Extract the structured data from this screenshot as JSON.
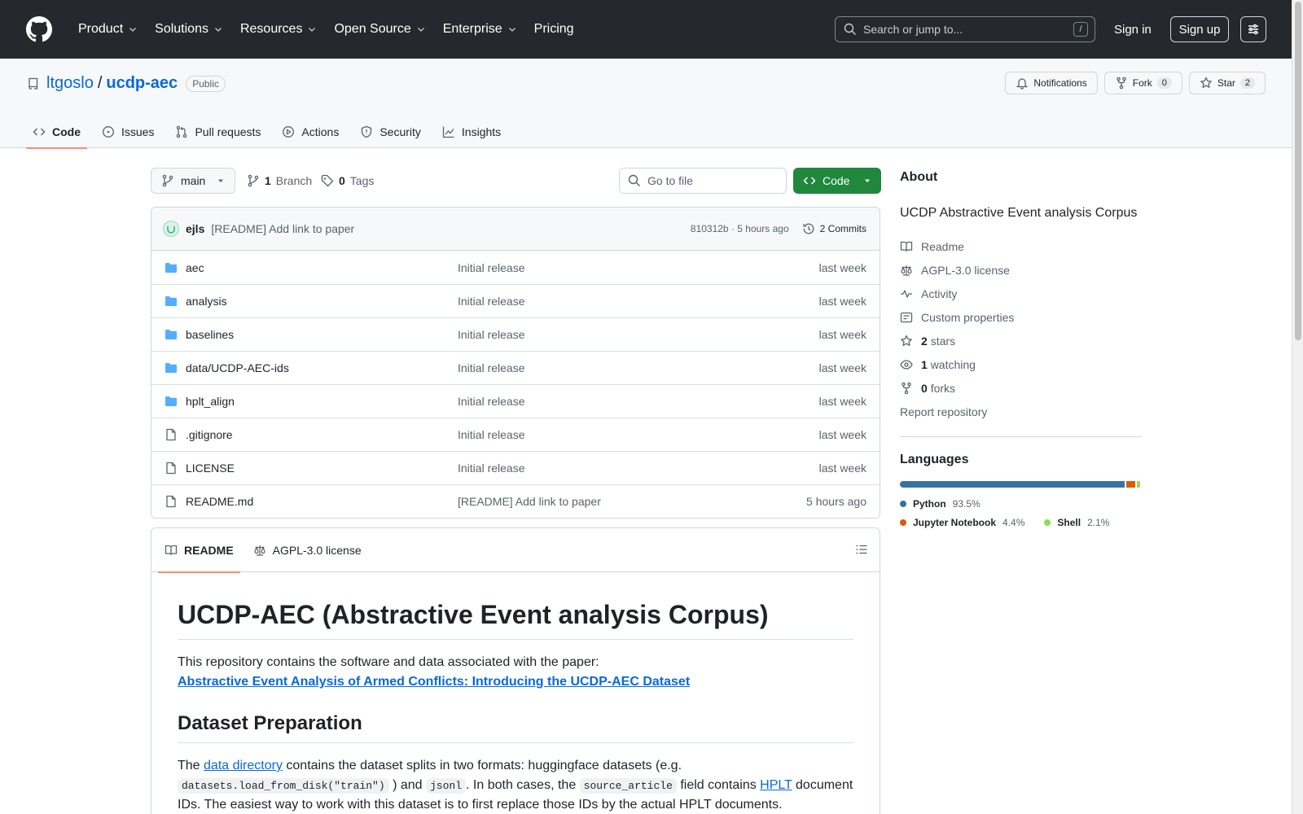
{
  "header": {
    "nav": [
      "Product",
      "Solutions",
      "Resources",
      "Open Source",
      "Enterprise",
      "Pricing"
    ],
    "search_placeholder": "Search or jump to...",
    "search_shortcut": "/",
    "sign_in": "Sign in",
    "sign_up": "Sign up"
  },
  "repo": {
    "owner": "ltgoslo",
    "separator": "/",
    "name": "ucdp-aec",
    "visibility": "Public",
    "notifications_label": "Notifications",
    "fork_label": "Fork",
    "fork_count": "0",
    "star_label": "Star",
    "star_count": "2",
    "tabs": [
      "Code",
      "Issues",
      "Pull requests",
      "Actions",
      "Security",
      "Insights"
    ]
  },
  "toolbar": {
    "branch": "main",
    "branch_count": "1",
    "branch_label": "Branch",
    "tag_count": "0",
    "tag_label": "Tags",
    "goto_placeholder": "Go to file",
    "code_label": "Code"
  },
  "commit": {
    "author": "ejls",
    "message": "[README] Add link to paper",
    "hash_time": "810312b · 5 hours ago",
    "commits": "2 Commits"
  },
  "files": [
    {
      "name": "aec",
      "type": "dir",
      "message": "Initial release",
      "age": "last week"
    },
    {
      "name": "analysis",
      "type": "dir",
      "message": "Initial release",
      "age": "last week"
    },
    {
      "name": "baselines",
      "type": "dir",
      "message": "Initial release",
      "age": "last week"
    },
    {
      "name": "data/UCDP-AEC-ids",
      "type": "dir",
      "message": "Initial release",
      "age": "last week"
    },
    {
      "name": "hplt_align",
      "type": "dir",
      "message": "Initial release",
      "age": "last week"
    },
    {
      "name": ".gitignore",
      "type": "file",
      "message": "Initial release",
      "age": "last week"
    },
    {
      "name": "LICENSE",
      "type": "file",
      "message": "Initial release",
      "age": "last week"
    },
    {
      "name": "README.md",
      "type": "file",
      "message": "[README] Add link to paper",
      "age": "5 hours ago"
    }
  ],
  "readme": {
    "tab_readme": "README",
    "tab_license": "AGPL-3.0 license",
    "h1": "UCDP-AEC (Abstractive Event analysis Corpus)",
    "p1": "This repository contains the software and data associated with the paper:",
    "paper_link": "Abstractive Event Analysis of Armed Conflicts: Introducing the UCDP-AEC Dataset",
    "h2": "Dataset Preparation",
    "p2_a": "The ",
    "p2_link1": "data directory",
    "p2_b": " contains the dataset splits in two formats: huggingface datasets (e.g. ",
    "p2_code1": "datasets.load_from_disk(\"train\")",
    "p2_c": " ) and ",
    "p2_code2": "jsonl",
    "p2_d": ". In both cases, the ",
    "p2_code3": "source_article",
    "p2_e": " field contains ",
    "p2_link2": "HPLT",
    "p2_f": " document IDs. The easiest way to work with this dataset is to first replace those IDs by the actual HPLT documents."
  },
  "about": {
    "title": "About",
    "description": "UCDP Abstractive Event analysis Corpus",
    "readme": "Readme",
    "license": "AGPL-3.0 license",
    "activity": "Activity",
    "custom_properties": "Custom properties",
    "stars_count": "2",
    "stars_label": "stars",
    "watching_count": "1",
    "watching_label": "watching",
    "forks_count": "0",
    "forks_label": "forks",
    "report": "Report repository"
  },
  "languages": {
    "title": "Languages",
    "items": [
      {
        "name": "Python",
        "percent": "93.5%",
        "value": 93.5,
        "color": "#3572A5"
      },
      {
        "name": "Jupyter Notebook",
        "percent": "4.4%",
        "value": 4.4,
        "color": "#DA5B0B"
      },
      {
        "name": "Shell",
        "percent": "2.1%",
        "value": 2.1,
        "color": "#89e051"
      }
    ]
  }
}
